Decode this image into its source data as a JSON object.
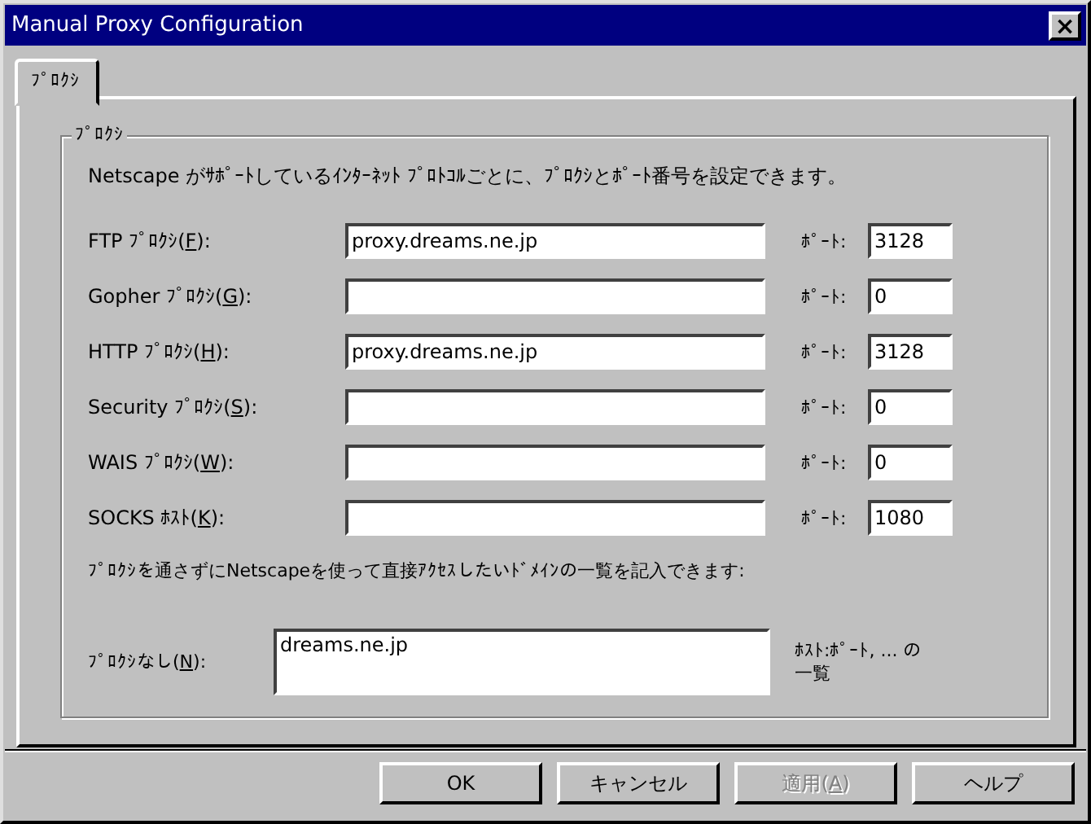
{
  "window": {
    "title": "Manual Proxy Configuration",
    "close": "×"
  },
  "tabs": [
    {
      "label": "ﾌﾟﾛｸｼ",
      "selected": true
    }
  ],
  "group": {
    "title": "ﾌﾟﾛｸｼ",
    "intro": "Netscape がｻﾎﾟｰﾄしているｲﾝﾀｰﾈｯﾄ ﾌﾟﾛﾄｺﾙごとに、ﾌﾟﾛｸｼとﾎﾟｰﾄ番号を設定できます。",
    "rows": [
      {
        "label": {
          "before": "FTP ﾌﾟﾛｸｼ(",
          "key": "F",
          "after": "):"
        },
        "value": "proxy.dreams.ne.jp",
        "port_label": "ﾎﾟｰﾄ:",
        "port": "3128"
      },
      {
        "label": {
          "before": "Gopher ﾌﾟﾛｸｼ(",
          "key": "G",
          "after": "):"
        },
        "port_label": "ﾎﾟｰﾄ:",
        "port": "0"
      },
      {
        "label": {
          "before": "HTTP ﾌﾟﾛｸｼ(",
          "key": "H",
          "after": "):"
        },
        "value": "proxy.dreams.ne.jp",
        "port_label": "ﾎﾟｰﾄ:",
        "port": "3128"
      },
      {
        "label": {
          "before": "Security ﾌﾟﾛｸｼ(",
          "key": "S",
          "after": "):"
        },
        "port_label": "ﾎﾟｰﾄ:",
        "port": "0"
      },
      {
        "label": {
          "before": "WAIS ﾌﾟﾛｸｼ(",
          "key": "W",
          "after": "):"
        },
        "port_label": "ﾎﾟｰﾄ:",
        "port": "0"
      },
      {
        "label": {
          "before": "SOCKS ﾎｽﾄ(",
          "key": "K",
          "after": "):"
        },
        "port_label": "ﾎﾟｰﾄ:",
        "port": "1080"
      }
    ],
    "bypass_note": "ﾌﾟﾛｸｼを通さずにNetscapeを使って直接ｱｸｾｽしたいﾄﾞﾒｲﾝの一覧を記入できます:",
    "bypass": {
      "label": {
        "before": "ﾌﾟﾛｸｼなし(",
        "key": "N",
        "after": "):"
      },
      "value": "dreams.ne.jp",
      "hint": "ﾎｽﾄ:ﾎﾟｰﾄ, ... の一覧"
    }
  },
  "buttons": [
    {
      "label": {
        "before": "OK"
      },
      "disabled": false
    },
    {
      "label": {
        "before": "キャンセル"
      },
      "disabled": false
    },
    {
      "label": {
        "before": "適用(",
        "key": "A",
        "after": ")"
      },
      "disabled": true
    },
    {
      "label": {
        "before": "ヘルプ"
      },
      "disabled": false
    }
  ]
}
